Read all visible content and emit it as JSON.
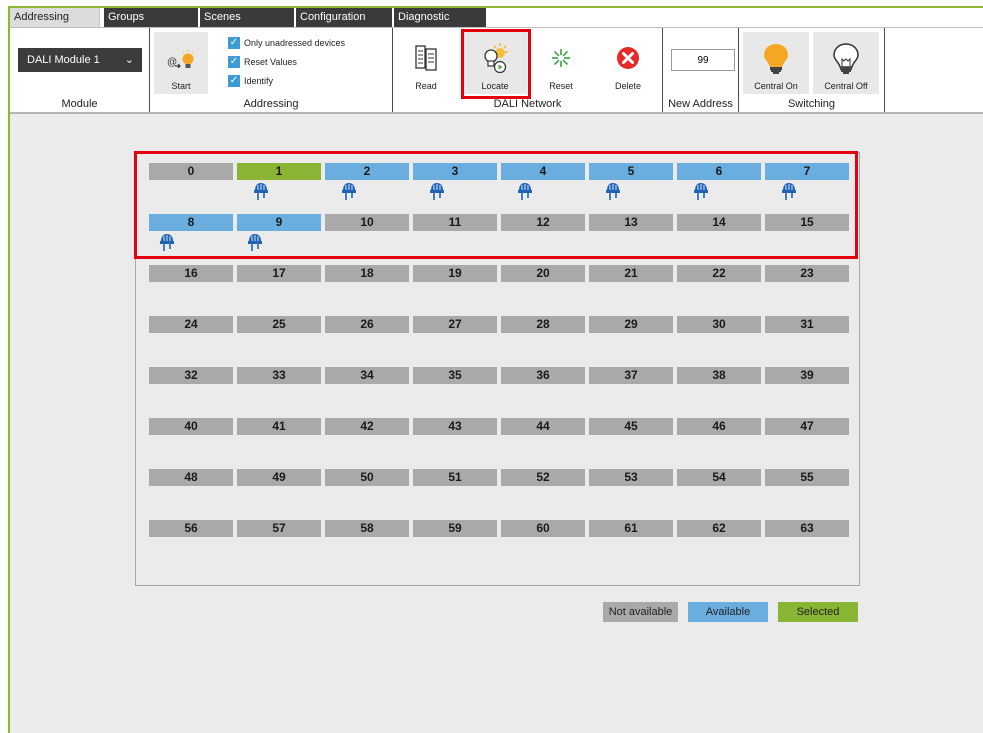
{
  "tabs": [
    {
      "label": "Addressing",
      "active": true
    },
    {
      "label": "Groups",
      "active": false
    },
    {
      "label": "Scenes",
      "active": false
    },
    {
      "label": "Configuration",
      "active": false
    },
    {
      "label": "Diagnostic",
      "active": false
    }
  ],
  "ribbon": {
    "module": {
      "selected": "DALI Module 1",
      "title": "Module"
    },
    "addressing": {
      "title": "Addressing",
      "start_label": "Start",
      "options": [
        {
          "label": "Only unadressed devices",
          "checked": true
        },
        {
          "label": "Reset Values",
          "checked": true
        },
        {
          "label": "Identify",
          "checked": true
        }
      ]
    },
    "dali_network": {
      "title": "DALI Network",
      "read_label": "Read",
      "locate_label": "Locate",
      "reset_label": "Reset",
      "delete_label": "Delete"
    },
    "new_address": {
      "value": "99",
      "title": "New Address"
    },
    "switching": {
      "title": "Switching",
      "central_on_label": "Central On",
      "central_off_label": "Central Off"
    }
  },
  "addresses": [
    {
      "n": "0",
      "state": "not_available",
      "device": false
    },
    {
      "n": "1",
      "state": "selected",
      "device": true
    },
    {
      "n": "2",
      "state": "available",
      "device": true
    },
    {
      "n": "3",
      "state": "available",
      "device": true
    },
    {
      "n": "4",
      "state": "available",
      "device": true
    },
    {
      "n": "5",
      "state": "available",
      "device": true
    },
    {
      "n": "6",
      "state": "available",
      "device": true
    },
    {
      "n": "7",
      "state": "available",
      "device": true
    },
    {
      "n": "8",
      "state": "available",
      "device": true
    },
    {
      "n": "9",
      "state": "available",
      "device": true
    },
    {
      "n": "10",
      "state": "not_available",
      "device": false
    },
    {
      "n": "11",
      "state": "not_available",
      "device": false
    },
    {
      "n": "12",
      "state": "not_available",
      "device": false
    },
    {
      "n": "13",
      "state": "not_available",
      "device": false
    },
    {
      "n": "14",
      "state": "not_available",
      "device": false
    },
    {
      "n": "15",
      "state": "not_available",
      "device": false
    },
    {
      "n": "16",
      "state": "not_available",
      "device": false
    },
    {
      "n": "17",
      "state": "not_available",
      "device": false
    },
    {
      "n": "18",
      "state": "not_available",
      "device": false
    },
    {
      "n": "19",
      "state": "not_available",
      "device": false
    },
    {
      "n": "20",
      "state": "not_available",
      "device": false
    },
    {
      "n": "21",
      "state": "not_available",
      "device": false
    },
    {
      "n": "22",
      "state": "not_available",
      "device": false
    },
    {
      "n": "23",
      "state": "not_available",
      "device": false
    },
    {
      "n": "24",
      "state": "not_available",
      "device": false
    },
    {
      "n": "25",
      "state": "not_available",
      "device": false
    },
    {
      "n": "26",
      "state": "not_available",
      "device": false
    },
    {
      "n": "27",
      "state": "not_available",
      "device": false
    },
    {
      "n": "28",
      "state": "not_available",
      "device": false
    },
    {
      "n": "29",
      "state": "not_available",
      "device": false
    },
    {
      "n": "30",
      "state": "not_available",
      "device": false
    },
    {
      "n": "31",
      "state": "not_available",
      "device": false
    },
    {
      "n": "32",
      "state": "not_available",
      "device": false
    },
    {
      "n": "33",
      "state": "not_available",
      "device": false
    },
    {
      "n": "34",
      "state": "not_available",
      "device": false
    },
    {
      "n": "35",
      "state": "not_available",
      "device": false
    },
    {
      "n": "36",
      "state": "not_available",
      "device": false
    },
    {
      "n": "37",
      "state": "not_available",
      "device": false
    },
    {
      "n": "38",
      "state": "not_available",
      "device": false
    },
    {
      "n": "39",
      "state": "not_available",
      "device": false
    },
    {
      "n": "40",
      "state": "not_available",
      "device": false
    },
    {
      "n": "41",
      "state": "not_available",
      "device": false
    },
    {
      "n": "42",
      "state": "not_available",
      "device": false
    },
    {
      "n": "43",
      "state": "not_available",
      "device": false
    },
    {
      "n": "44",
      "state": "not_available",
      "device": false
    },
    {
      "n": "45",
      "state": "not_available",
      "device": false
    },
    {
      "n": "46",
      "state": "not_available",
      "device": false
    },
    {
      "n": "47",
      "state": "not_available",
      "device": false
    },
    {
      "n": "48",
      "state": "not_available",
      "device": false
    },
    {
      "n": "49",
      "state": "not_available",
      "device": false
    },
    {
      "n": "50",
      "state": "not_available",
      "device": false
    },
    {
      "n": "51",
      "state": "not_available",
      "device": false
    },
    {
      "n": "52",
      "state": "not_available",
      "device": false
    },
    {
      "n": "53",
      "state": "not_available",
      "device": false
    },
    {
      "n": "54",
      "state": "not_available",
      "device": false
    },
    {
      "n": "55",
      "state": "not_available",
      "device": false
    },
    {
      "n": "56",
      "state": "not_available",
      "device": false
    },
    {
      "n": "57",
      "state": "not_available",
      "device": false
    },
    {
      "n": "58",
      "state": "not_available",
      "device": false
    },
    {
      "n": "59",
      "state": "not_available",
      "device": false
    },
    {
      "n": "60",
      "state": "not_available",
      "device": false
    },
    {
      "n": "61",
      "state": "not_available",
      "device": false
    },
    {
      "n": "62",
      "state": "not_available",
      "device": false
    },
    {
      "n": "63",
      "state": "not_available",
      "device": false
    }
  ],
  "legend": {
    "not_available": "Not available",
    "available": "Available",
    "selected": "Selected"
  },
  "colors": {
    "accent": "#8ab833",
    "not_available": "#a9a9a9",
    "available": "#6aaee0",
    "selected": "#8ab433",
    "highlight": "#e3000f"
  }
}
